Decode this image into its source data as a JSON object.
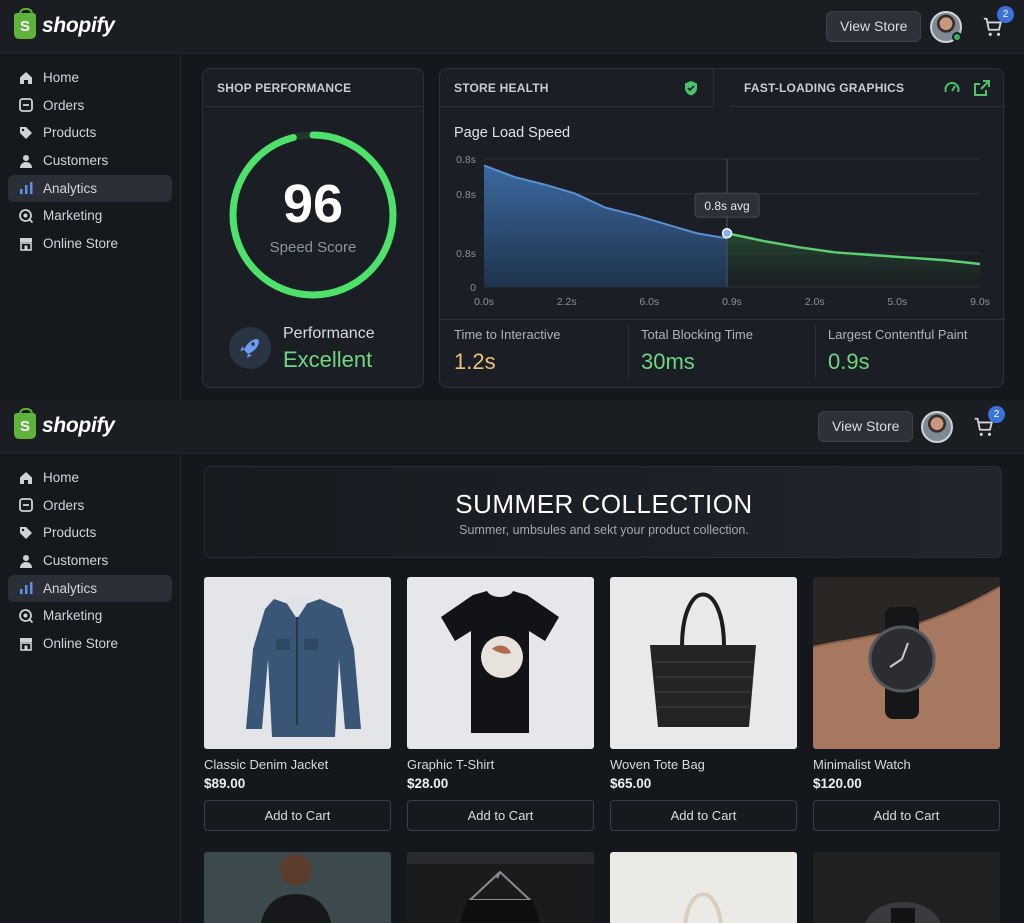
{
  "brand": {
    "name": "shopify",
    "glyph": "S"
  },
  "header": {
    "view_store": "View Store",
    "cart_count": "2"
  },
  "sidebar": {
    "items": [
      {
        "label": "Home",
        "icon": "home-icon"
      },
      {
        "label": "Orders",
        "icon": "orders-icon"
      },
      {
        "label": "Products",
        "icon": "tag-icon"
      },
      {
        "label": "Customers",
        "icon": "person-icon"
      },
      {
        "label": "Analytics",
        "icon": "bar-chart-icon",
        "active": true
      },
      {
        "label": "Marketing",
        "icon": "target-icon"
      },
      {
        "label": "Online Store",
        "icon": "store-icon"
      }
    ]
  },
  "dashboard": {
    "shop_performance": {
      "title": "SHOP PERFORMANCE",
      "score": "96",
      "score_label": "Speed Score",
      "score_fraction": 0.96,
      "perf_label": "Performance",
      "perf_value": "Excellent"
    },
    "store_health": {
      "title": "STORE HEALTH",
      "icon": "shield-check-icon"
    },
    "fast_loading": {
      "title": "FAST-LOADING GRAPHICS",
      "icons": [
        "speedometer-icon",
        "external-link-icon"
      ]
    },
    "metrics": [
      {
        "label": "Time to Interactive",
        "value": "1.2s",
        "color": "#e8c27a"
      },
      {
        "label": "Total Blocking Time",
        "value": "30ms",
        "color": "#6fd681"
      },
      {
        "label": "Largest Contentful Paint",
        "value": "0.9s",
        "color": "#6fd681"
      }
    ]
  },
  "chart_data": {
    "type": "area",
    "title": "Page Load Speed",
    "y_ticks": [
      "0.8s",
      "0.8s",
      "0.8s",
      "0"
    ],
    "x_ticks": [
      "0.0s",
      "2.2s",
      "6.0s",
      "0.9s",
      "2.0s",
      "5.0s",
      "9.0s"
    ],
    "annotation": "0.8s avg",
    "grid": true,
    "series": [
      {
        "values": [
          0.95,
          0.86,
          0.8,
          0.73,
          0.62,
          0.56,
          0.49,
          0.42,
          0.38
        ],
        "color": "#3d6ea8"
      },
      {
        "values": [
          0.42,
          0.36,
          0.31,
          0.27,
          0.25,
          0.23,
          0.21,
          0.18
        ],
        "color": "#5dcf72"
      }
    ]
  },
  "store": {
    "banner_title": "SUMMER COLLECTION",
    "banner_sub": "Summer, umbsules and sekt your product collection.",
    "add_to_cart": "Add to Cart",
    "products": [
      {
        "name": "Classic Denim Jacket",
        "price": "$89.00"
      },
      {
        "name": "Graphic T-Shirt",
        "price": "$28.00"
      },
      {
        "name": "Woven Tote Bag",
        "price": "$65.00"
      },
      {
        "name": "Minimalist Watch",
        "price": "$120.00"
      }
    ]
  }
}
